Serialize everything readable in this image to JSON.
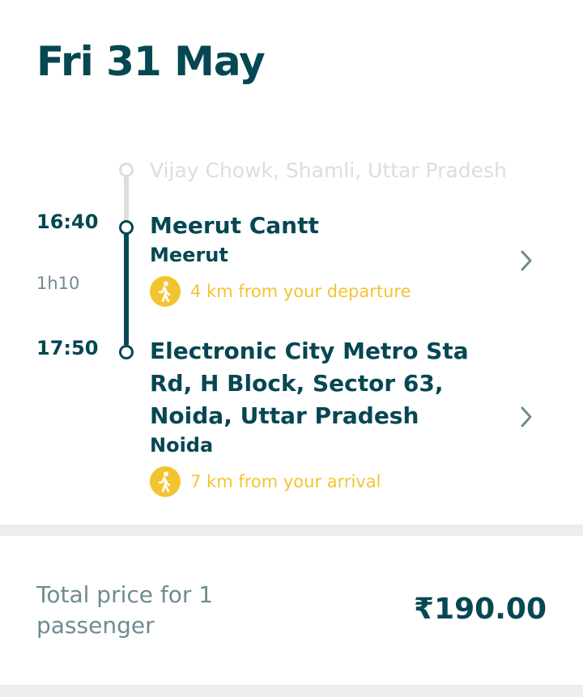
{
  "header": {
    "date": "Fri 31 May"
  },
  "trip": {
    "via": "Vijay Chowk, Shamli, Uttar Pradesh",
    "duration": "1h10",
    "departure": {
      "time": "16:40",
      "name": "Meerut Cantt",
      "city": "Meerut",
      "walk_note": "4 km from your departure"
    },
    "arrival": {
      "time": "17:50",
      "name": "Electronic City Metro Sta Rd, H Block, Sector 63, Noida, Uttar Pradesh",
      "city": "Noida",
      "walk_note": "7 km from your arrival"
    }
  },
  "price": {
    "label": "Total price for 1 passenger",
    "value": "₹190.00"
  },
  "colors": {
    "primary": "#054752",
    "accent_yellow": "#f4c430",
    "muted": "#6f8b90",
    "disabled": "#dddddd"
  },
  "icons": [
    "walking-person-icon",
    "chevron-right-icon"
  ]
}
